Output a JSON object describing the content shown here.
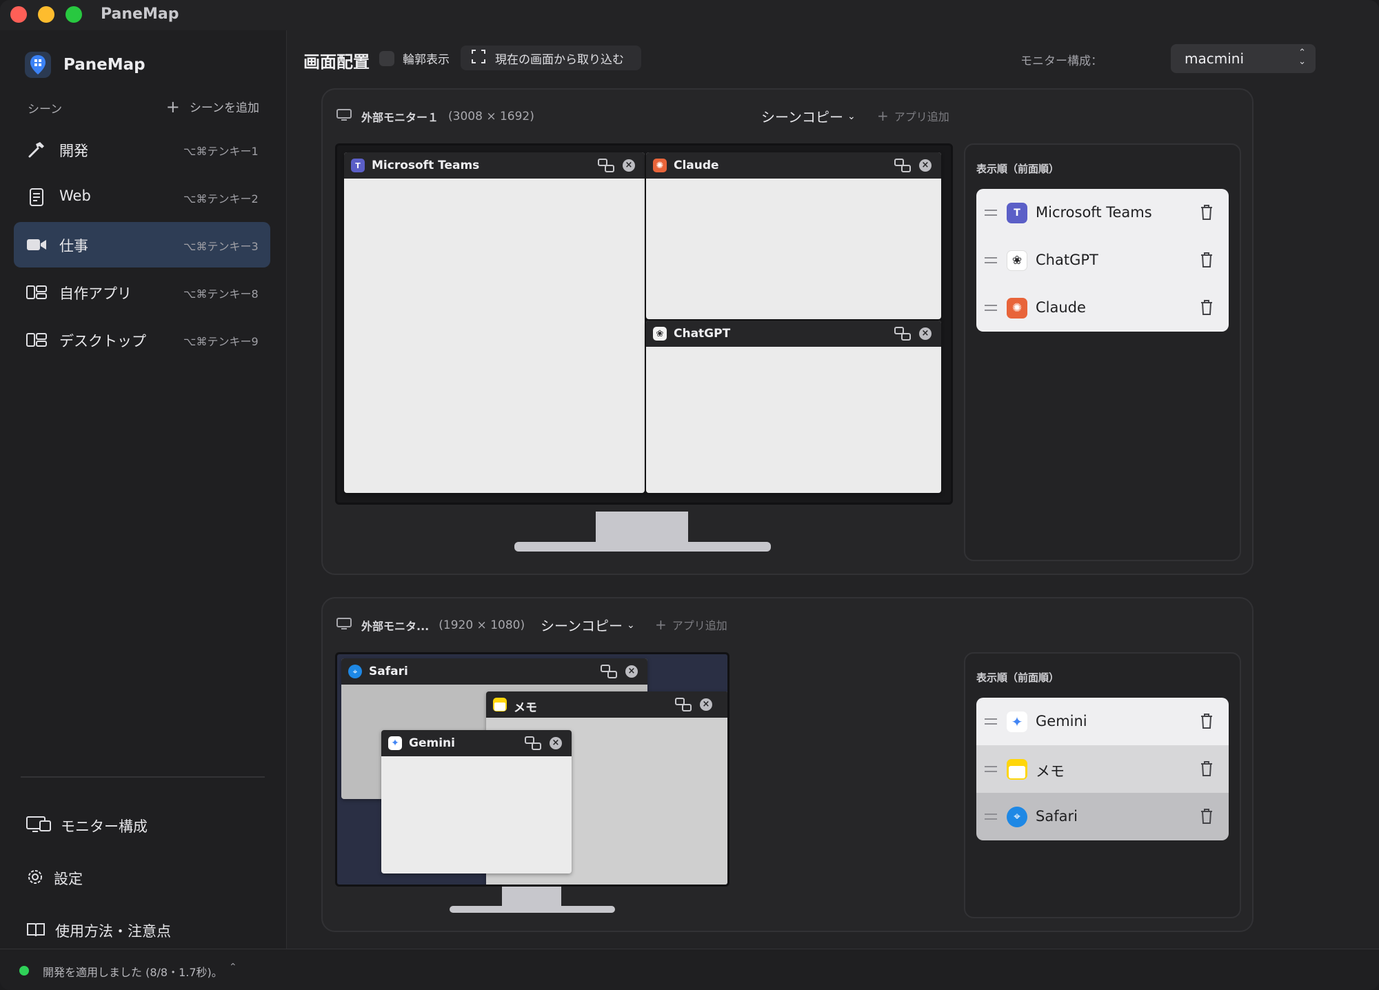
{
  "app": {
    "title": "PaneMap",
    "brand_name": "PaneMap"
  },
  "sidebar": {
    "scenes_label": "シーン",
    "add_scene_label": "シーンを追加",
    "scenes": [
      {
        "label": "開発",
        "shortcut": "⌥⌘テンキー1",
        "icon": "hammer-icon",
        "active": false
      },
      {
        "label": "Web",
        "shortcut": "⌥⌘テンキー2",
        "icon": "document-icon",
        "active": false
      },
      {
        "label": "仕事",
        "shortcut": "⌥⌘テンキー3",
        "icon": "video-camera-icon",
        "active": true
      },
      {
        "label": "自作アプリ",
        "shortcut": "⌥⌘テンキー8",
        "icon": "layout-icon",
        "active": false
      },
      {
        "label": "デスクトップ",
        "shortcut": "⌥⌘テンキー9",
        "icon": "layout-icon",
        "active": false
      }
    ],
    "links": {
      "monitor_config": "モニター構成",
      "settings": "設定",
      "usage": "使用方法・注意点"
    }
  },
  "toolbar": {
    "title": "画面配置",
    "outline_label": "輪郭表示",
    "capture_label": "現在の画面から取り込む",
    "monitor_config_label": "モニター構成：",
    "monitor_select_value": "macmini"
  },
  "monitors": [
    {
      "name": "外部モニター１",
      "resolution": "(3008 × 1692)",
      "scene_copy_label": "シーンコピー",
      "add_app_label": "アプリ追加",
      "windows": [
        {
          "title": "Microsoft Teams",
          "icon": "teams-icon"
        },
        {
          "title": "Claude",
          "icon": "claude-icon"
        },
        {
          "title": "ChatGPT",
          "icon": "chatgpt-icon"
        }
      ],
      "order_title": "表示順（前面順）",
      "order": [
        {
          "name": "Microsoft Teams",
          "icon": "teams-icon"
        },
        {
          "name": "ChatGPT",
          "icon": "chatgpt-icon"
        },
        {
          "name": "Claude",
          "icon": "claude-icon"
        }
      ]
    },
    {
      "name": "外部モニタ...",
      "resolution": "(1920 × 1080)",
      "scene_copy_label": "シーンコピー",
      "add_app_label": "アプリ追加",
      "windows": [
        {
          "title": "Safari",
          "icon": "safari-icon"
        },
        {
          "title": "メモ",
          "icon": "notes-icon"
        },
        {
          "title": "Gemini",
          "icon": "gemini-icon"
        }
      ],
      "order_title": "表示順（前面順）",
      "order": [
        {
          "name": "Gemini",
          "icon": "gemini-icon"
        },
        {
          "name": "メモ",
          "icon": "notes-icon"
        },
        {
          "name": "Safari",
          "icon": "safari-icon"
        }
      ]
    }
  ],
  "status": {
    "text": "開発を適用しました (8/8・1.7秒)。"
  },
  "colors": {
    "accent_active": "#2e3d55",
    "status_ok": "#2fd158",
    "teams": "#5b5fc7",
    "claude": "#e8643a",
    "safari": "#1e88e5",
    "notes": "#ffd60a"
  }
}
